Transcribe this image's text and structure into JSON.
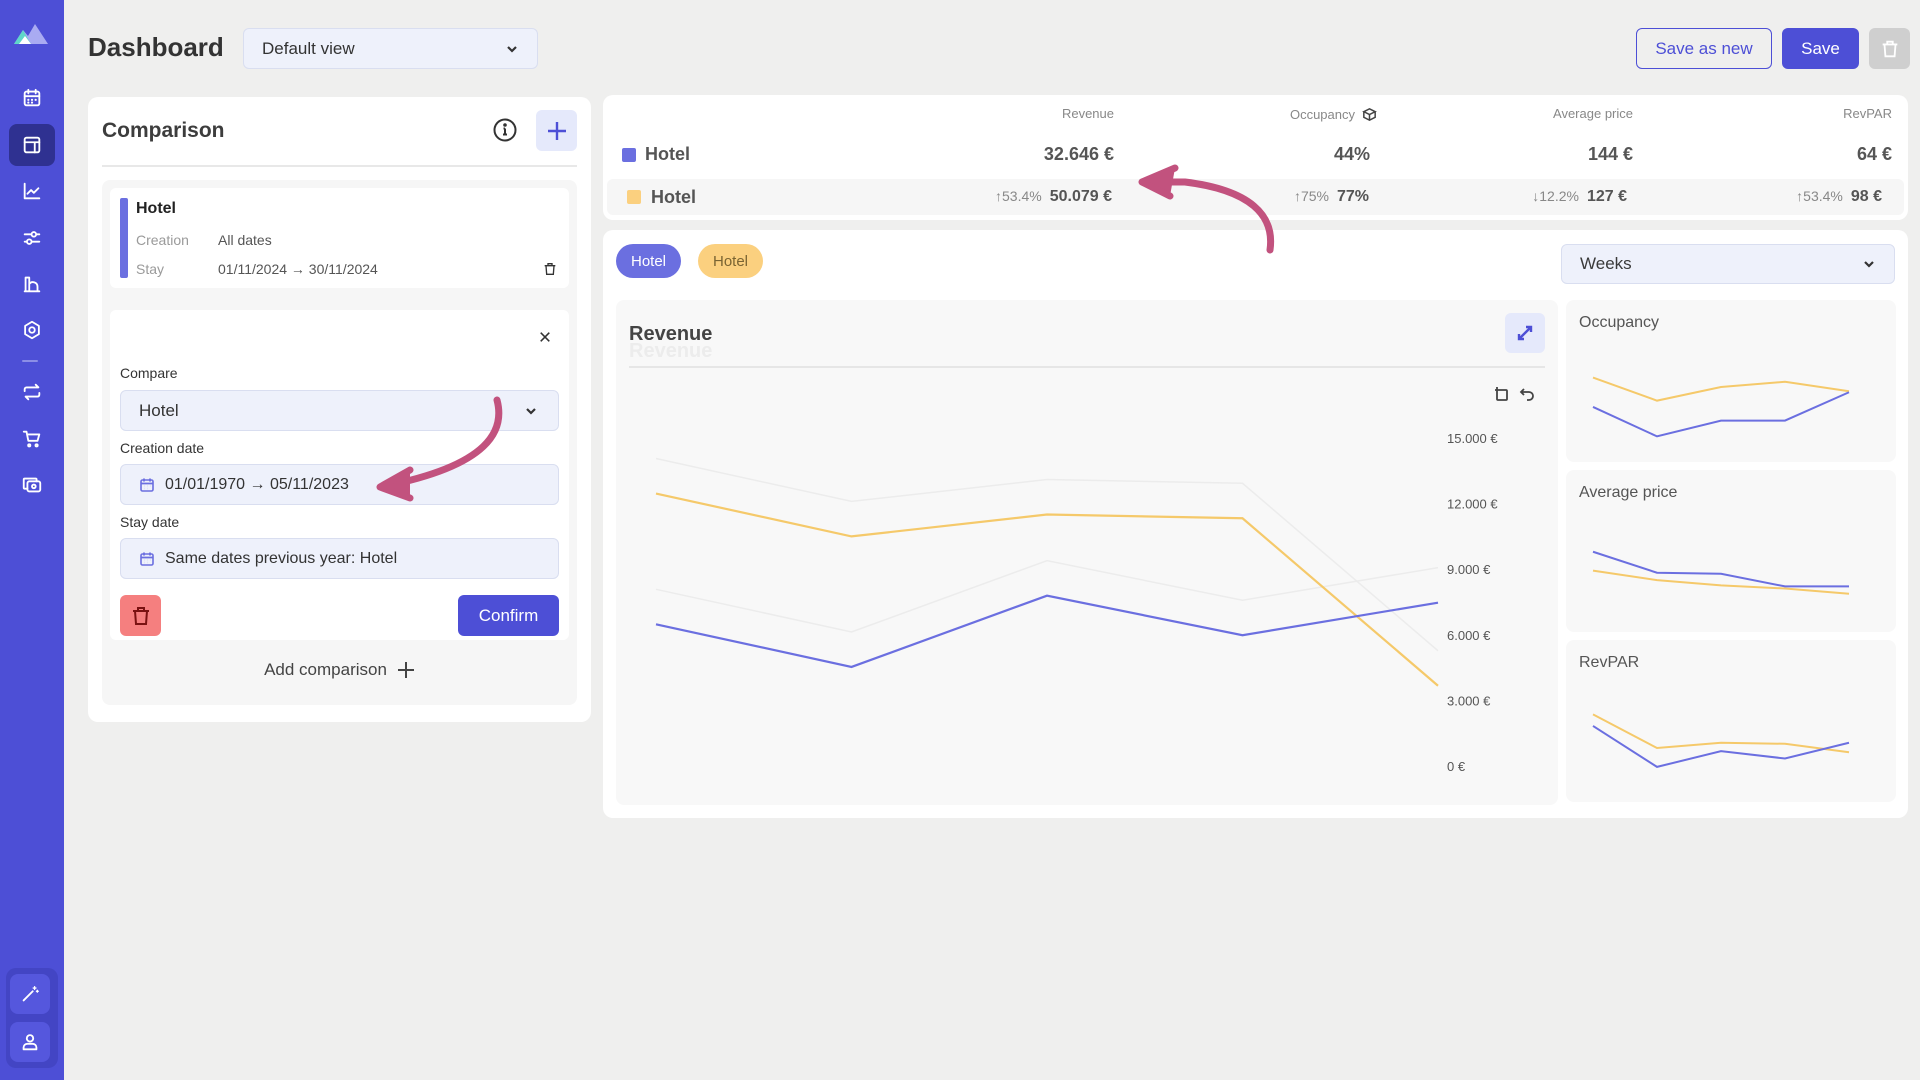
{
  "sidebar": {
    "logo": "mountain-logo",
    "items": [
      {
        "name": "calendar",
        "icon": "calendar-icon",
        "active": false
      },
      {
        "name": "dashboard",
        "icon": "layout-icon",
        "active": true
      },
      {
        "name": "analytics",
        "icon": "line-chart-icon",
        "active": false
      },
      {
        "name": "filters",
        "icon": "sliders-icon",
        "active": false
      },
      {
        "name": "pricing",
        "icon": "building-icon",
        "active": false
      },
      {
        "name": "settings",
        "icon": "gear-icon",
        "active": false
      },
      {
        "name": "sync",
        "icon": "repeat-icon",
        "active": false
      },
      {
        "name": "shop",
        "icon": "cart-icon",
        "active": false
      },
      {
        "name": "payments",
        "icon": "money-icon",
        "active": false
      }
    ],
    "bottom": [
      {
        "name": "magic",
        "icon": "magic-wand-icon"
      },
      {
        "name": "profile",
        "icon": "user-icon"
      }
    ]
  },
  "header": {
    "title": "Dashboard",
    "view_select": "Default view",
    "save_as_new": "Save as new",
    "save": "Save"
  },
  "comparison": {
    "title": "Comparison",
    "card": {
      "name": "Hotel",
      "creation_label": "Creation",
      "creation_value": "All dates",
      "stay_label": "Stay",
      "stay_value": "01/11/2024 → 30/11/2024",
      "color": "#6b6fe0"
    },
    "form": {
      "compare_label": "Compare",
      "compare_value": "Hotel",
      "creation_label": "Creation date",
      "creation_value": "01/01/1970 → 05/11/2023",
      "stay_label": "Stay date",
      "stay_value": "Same dates previous year: Hotel",
      "confirm": "Confirm"
    },
    "add_comparison": "Add comparison"
  },
  "metrics": {
    "headers": [
      "Revenue",
      "Occupancy",
      "Average price",
      "RevPAR"
    ],
    "rows": [
      {
        "name": "Hotel",
        "color": "#6b6fe0",
        "values": [
          "32.646 €",
          "44%",
          "144 €",
          "64 €"
        ],
        "deltas": [
          "",
          "",
          "",
          ""
        ]
      },
      {
        "name": "Hotel",
        "color": "#fbd07f",
        "values": [
          "50.079 €",
          "77%",
          "127 €",
          "98 €"
        ],
        "deltas": [
          "↑53.4%",
          "↑75%",
          "↓12.2%",
          "↑53.4%"
        ]
      }
    ]
  },
  "chart_controls": {
    "pills": [
      "Hotel",
      "Hotel"
    ],
    "granularity": "Weeks"
  },
  "chart_data": [
    {
      "type": "line",
      "title": "Revenue",
      "x": [
        1,
        2,
        3,
        4,
        5
      ],
      "yticks": [
        "15.000 €",
        "12.000 €",
        "9.000 €",
        "6.000 €",
        "3.000 €",
        "0 €"
      ],
      "ylim": [
        0,
        15000
      ],
      "grid": false,
      "series": [
        {
          "name": "Hotel",
          "color": "#6b6fe0",
          "values": [
            6480,
            4530,
            7790,
            5980,
            7470
          ]
        },
        {
          "name": "Hotel (comparison)",
          "color": "#f5c96a",
          "values": [
            12460,
            10500,
            11500,
            11330,
            3670
          ]
        }
      ]
    },
    {
      "type": "line",
      "title": "Occupancy",
      "x": [
        1,
        2,
        3,
        4,
        5
      ],
      "series": [
        {
          "name": "Hotel",
          "color": "#6b6fe0",
          "values": [
            41,
            13,
            28,
            28,
            55
          ]
        },
        {
          "name": "Hotel (comparison)",
          "color": "#f5c96a",
          "values": [
            69,
            47,
            60,
            65,
            56
          ]
        }
      ]
    },
    {
      "type": "line",
      "title": "Average price",
      "x": [
        1,
        2,
        3,
        4,
        5
      ],
      "series": [
        {
          "name": "Hotel",
          "color": "#6b6fe0",
          "values": [
            65,
            45,
            44,
            32,
            32
          ]
        },
        {
          "name": "Hotel (comparison)",
          "color": "#f5c96a",
          "values": [
            47,
            38,
            33,
            30,
            25
          ]
        }
      ]
    },
    {
      "type": "line",
      "title": "RevPAR",
      "x": [
        1,
        2,
        3,
        4,
        5
      ],
      "series": [
        {
          "name": "Hotel",
          "color": "#6b6fe0",
          "values": [
            61,
            22,
            37,
            30,
            45
          ]
        },
        {
          "name": "Hotel (comparison)",
          "color": "#f5c96a",
          "values": [
            72,
            40,
            45,
            44,
            36
          ]
        }
      ]
    }
  ]
}
